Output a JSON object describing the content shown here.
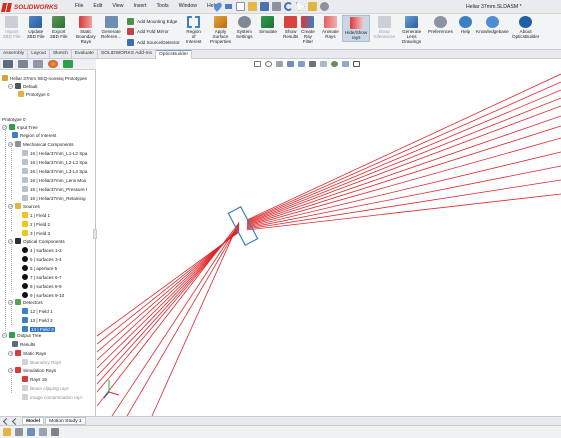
{
  "app": {
    "name": "SOLIDWORKS",
    "document_title": "Heliar 37mm.SLDASM *"
  },
  "menus": [
    "File",
    "Edit",
    "View",
    "Insert",
    "Tools",
    "Window",
    "Help"
  ],
  "quick_access_icons": [
    "pin-icon",
    "home-icon",
    "new-icon",
    "open-icon",
    "save-icon",
    "print-icon",
    "undo-icon",
    "select-icon",
    "rebuild-icon",
    "options-icon"
  ],
  "ribbon": {
    "import_2bd": "Import\n2BD File",
    "update_2bd": "Update\n2BD File",
    "export_2bd": "Export\n2BD File",
    "static_boundary": "Static\nBoundary\nRays",
    "generate_reference": "Generate\nReferen...",
    "add_mounting_edge": "Add Mounting Edge",
    "add_fold_mirror": "Add Fold Mirror",
    "add_source_detector": "Add Source/Detector",
    "region_of_interest": "Region\nof\nInterest",
    "apply_surface": "Apply\nSurface\nProperties",
    "system_settings": "System\nSettings",
    "simulate": "Simulate",
    "show_results": "Show\nResults",
    "create_ray_filter": "Create\nRay\nFilter",
    "animate_rays": "Animate\nRays",
    "hide_show_rays": "Hide/Show\nrays",
    "show_tolerances": "Show\nTolerances",
    "generate_lens_drawings": "Generate\nLens\nDrawings",
    "preferences": "Preferences",
    "help": "Help",
    "knowledgebase": "Knowledgebase",
    "about": "About\nOpticsBuilder"
  },
  "tabs": [
    "Assembly",
    "Layout",
    "Sketch",
    "Evaluate",
    "SOLIDWORKS Add-Ins",
    "OpticsBuilder"
  ],
  "active_tab": "OpticsBuilder",
  "tree": {
    "root": "Heliar 37mm SEQ-nonseq Prototypes",
    "default": "Default",
    "prototype_top": "Prototype 0",
    "prototype": "Prototype 0",
    "input_tree": "Input Tree",
    "region_of_interest": "Region of Interest",
    "mechanical": "Mechanical Components",
    "mech_items": [
      "16 | Heliar37mm_L1-L2 Spa",
      "16 | Heliar37mm_L2-L3 Spa",
      "16 | Heliar37mm_L3-L4 Spa",
      "16 | Heliar37mm_Lens Mou",
      "15 | Heliar37mm_Pressure I",
      "16 | Heliar37mm_Retaining"
    ],
    "sources": "Sources",
    "source_items": [
      "1 | Field 1",
      "2 | Field 2",
      "3 | Field 3"
    ],
    "optical": "Optical Components",
    "optical_items": [
      "4 | surfaces 1-2",
      "5 | surfaces 3-4",
      "6 | aperture 5",
      "7 | surfaces 6-7",
      "8 | surfaces 8-9",
      "9 | surfaces 9-10"
    ],
    "detectors": "Detectors",
    "detector_items": [
      "12 | Field 1",
      "13 | Field 2",
      "14 | Field 3"
    ],
    "selected_detector_index": 2,
    "output_tree": "Output Tree",
    "results": "Results",
    "static_rays": "Static Rays",
    "boundary_rays": "Boundary Rays",
    "simulation_rays": "Simulation Rays",
    "rays_19": "Rays 19",
    "beam_clipping": "Beam clipping rays",
    "image_contamination": "Image contamination rays"
  },
  "bottom_tabs": [
    "Model",
    "Motion Study 1"
  ],
  "active_bottom_tab": "Model",
  "colors": {
    "ray": "#e0262a",
    "detector": "#3b7fc4",
    "accent": "#d52b1e",
    "selection": "#2f73c9"
  }
}
